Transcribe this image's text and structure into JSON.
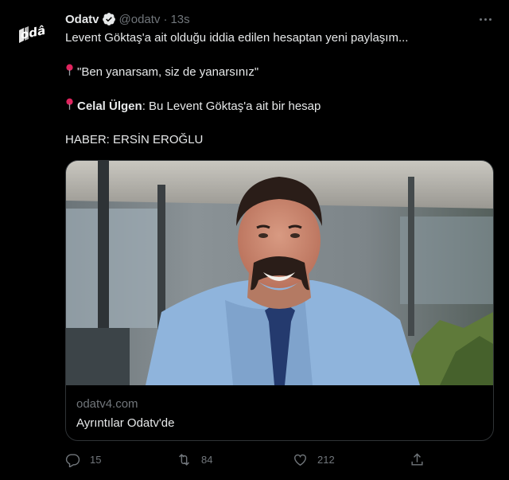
{
  "tweet": {
    "display_name": "Odatv",
    "handle": "@odatv",
    "separator": "·",
    "time": "13s",
    "avatar_logo_text": "odâ",
    "lines": [
      {
        "text": "Levent Göktaş'a ait olduğu iddia edilen hesaptan yeni paylaşım...",
        "pin": false
      },
      {
        "text": "\"Ben yanarsam, siz de yanarsınız\"",
        "pin": true
      },
      {
        "pin": true,
        "bold_part": "Celal Ülgen",
        "rest": ": Bu Levent Göktaş'a ait bir hesap"
      },
      {
        "text": "HABER: ERSİN EROĞLU",
        "pin": false
      }
    ]
  },
  "card": {
    "domain": "odatv4.com",
    "title": "Ayrıntılar Odatv'de"
  },
  "actions": {
    "reply_count": "15",
    "retweet_count": "84",
    "like_count": "212"
  },
  "icons": [
    "verified-badge-icon",
    "more-icon",
    "pin-icon",
    "reply-icon",
    "retweet-icon",
    "like-icon",
    "share-icon"
  ],
  "colors": {
    "background": "#000000",
    "text": "#e7e9ea",
    "muted": "#71767b",
    "pin": "#e0245e",
    "border": "#2f3336"
  }
}
